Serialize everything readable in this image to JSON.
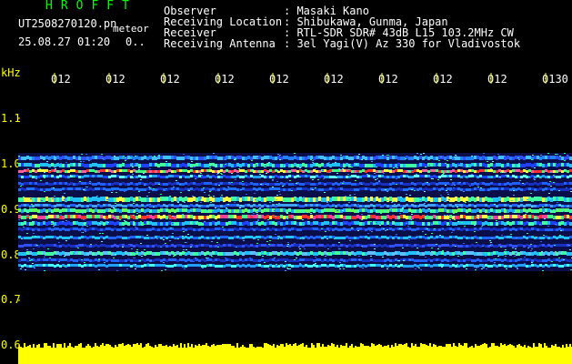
{
  "header": {
    "brand": "HROFFT",
    "filename": "UT2508270120.pn",
    "filename_suffix": "meteor",
    "datetime": "25.08.27 01:20",
    "count": "0..",
    "fields": [
      {
        "label": "Observer",
        "value": ": Masaki Kano"
      },
      {
        "label": "Receiving Location",
        "value": ": Shibukawa, Gunma, Japan"
      },
      {
        "label": "Receiver",
        "value": ": RTL-SDR SDR# 43dB L15 103.2MHz CW"
      },
      {
        "label": "Receiving Antenna",
        "value": ": 3el Yagi(V) Az 330 for Vladivostok"
      }
    ]
  },
  "axis": {
    "unit": "kHz",
    "y_ticks": [
      "1.1",
      "1.0",
      "0.9",
      "0.8",
      "0.7",
      "0.6"
    ],
    "x_ticks": [
      "012",
      "012",
      "012",
      "012",
      "012",
      "012",
      "012",
      "012",
      "012",
      "0130"
    ]
  },
  "colors": {
    "background": "#000000",
    "header_text": "#ffffff",
    "brand": "#00ff00",
    "tick": "#ffff00",
    "noise_fill": "#ffff00"
  }
}
